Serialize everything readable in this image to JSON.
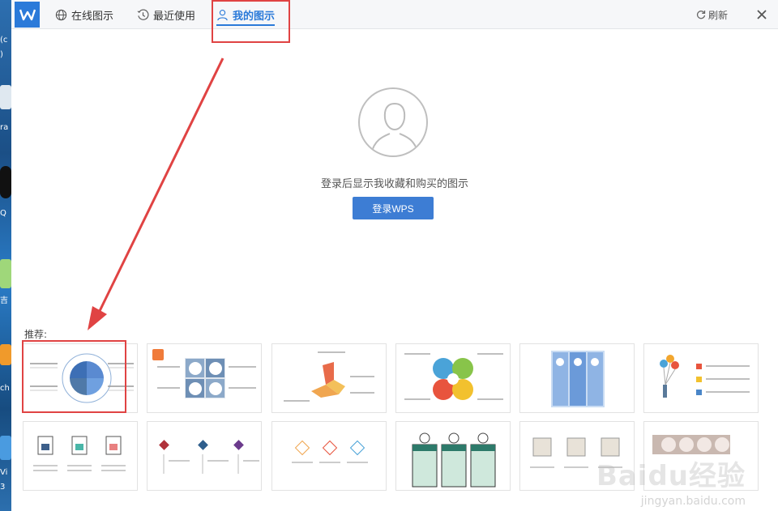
{
  "tabs": [
    {
      "label": "在线图示",
      "icon": "globe-icon"
    },
    {
      "label": "最近使用",
      "icon": "clock-icon"
    },
    {
      "label": "我的图示",
      "icon": "user-icon",
      "active": true
    }
  ],
  "toolbar": {
    "refresh_label": "刷新"
  },
  "login": {
    "message": "登录后显示我收藏和购买的图示",
    "button_label": "登录WPS"
  },
  "recommended": {
    "label": "推荐:"
  },
  "desktop_fragments": [
    "(c",
    ")",
    "ra",
    "Q",
    "吉",
    "ch",
    "Vi",
    "3"
  ],
  "watermark": {
    "brand": "Baidu经验",
    "url": "jingyan.baidu.com"
  },
  "colors": {
    "accent": "#2b7ad9",
    "highlight": "#e04343",
    "button": "#3d7dd4"
  }
}
